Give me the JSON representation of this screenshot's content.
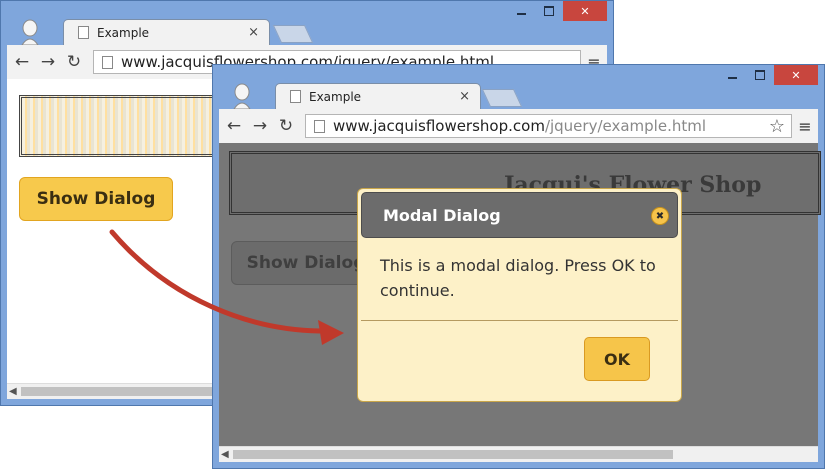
{
  "back_window": {
    "tab_title": "Example",
    "tab_close": "×",
    "url_visible": "www.jacquisflowershop.com/jquery/example.html",
    "show_dialog_label": "Show Dialog",
    "window_controls": {
      "close": "✕"
    }
  },
  "front_window": {
    "tab_title": "Example",
    "tab_close": "×",
    "url_host": "www.jacquisflowershop.com",
    "url_path": "/jquery/example.html",
    "banner_title": "Jacqui's Flower Shop",
    "show_dialog_label": "Show Dialog",
    "window_controls": {
      "close": "✕"
    }
  },
  "dialog": {
    "title": "Modal Dialog",
    "close_icon": "close-icon",
    "body": "This is a modal dialog. Press OK to continue.",
    "ok_label": "OK"
  },
  "colors": {
    "chrome_frame": "#7fa6dc",
    "close_button": "#c8463e",
    "button_gold": "#f7c94c",
    "dialog_bg": "#fdf1c8",
    "overlay_gray": "#777777",
    "arrow_red": "#c0392b"
  },
  "icons": {
    "back": "←",
    "forward": "→",
    "reload": "↻",
    "star": "☆",
    "menu": "≡"
  }
}
